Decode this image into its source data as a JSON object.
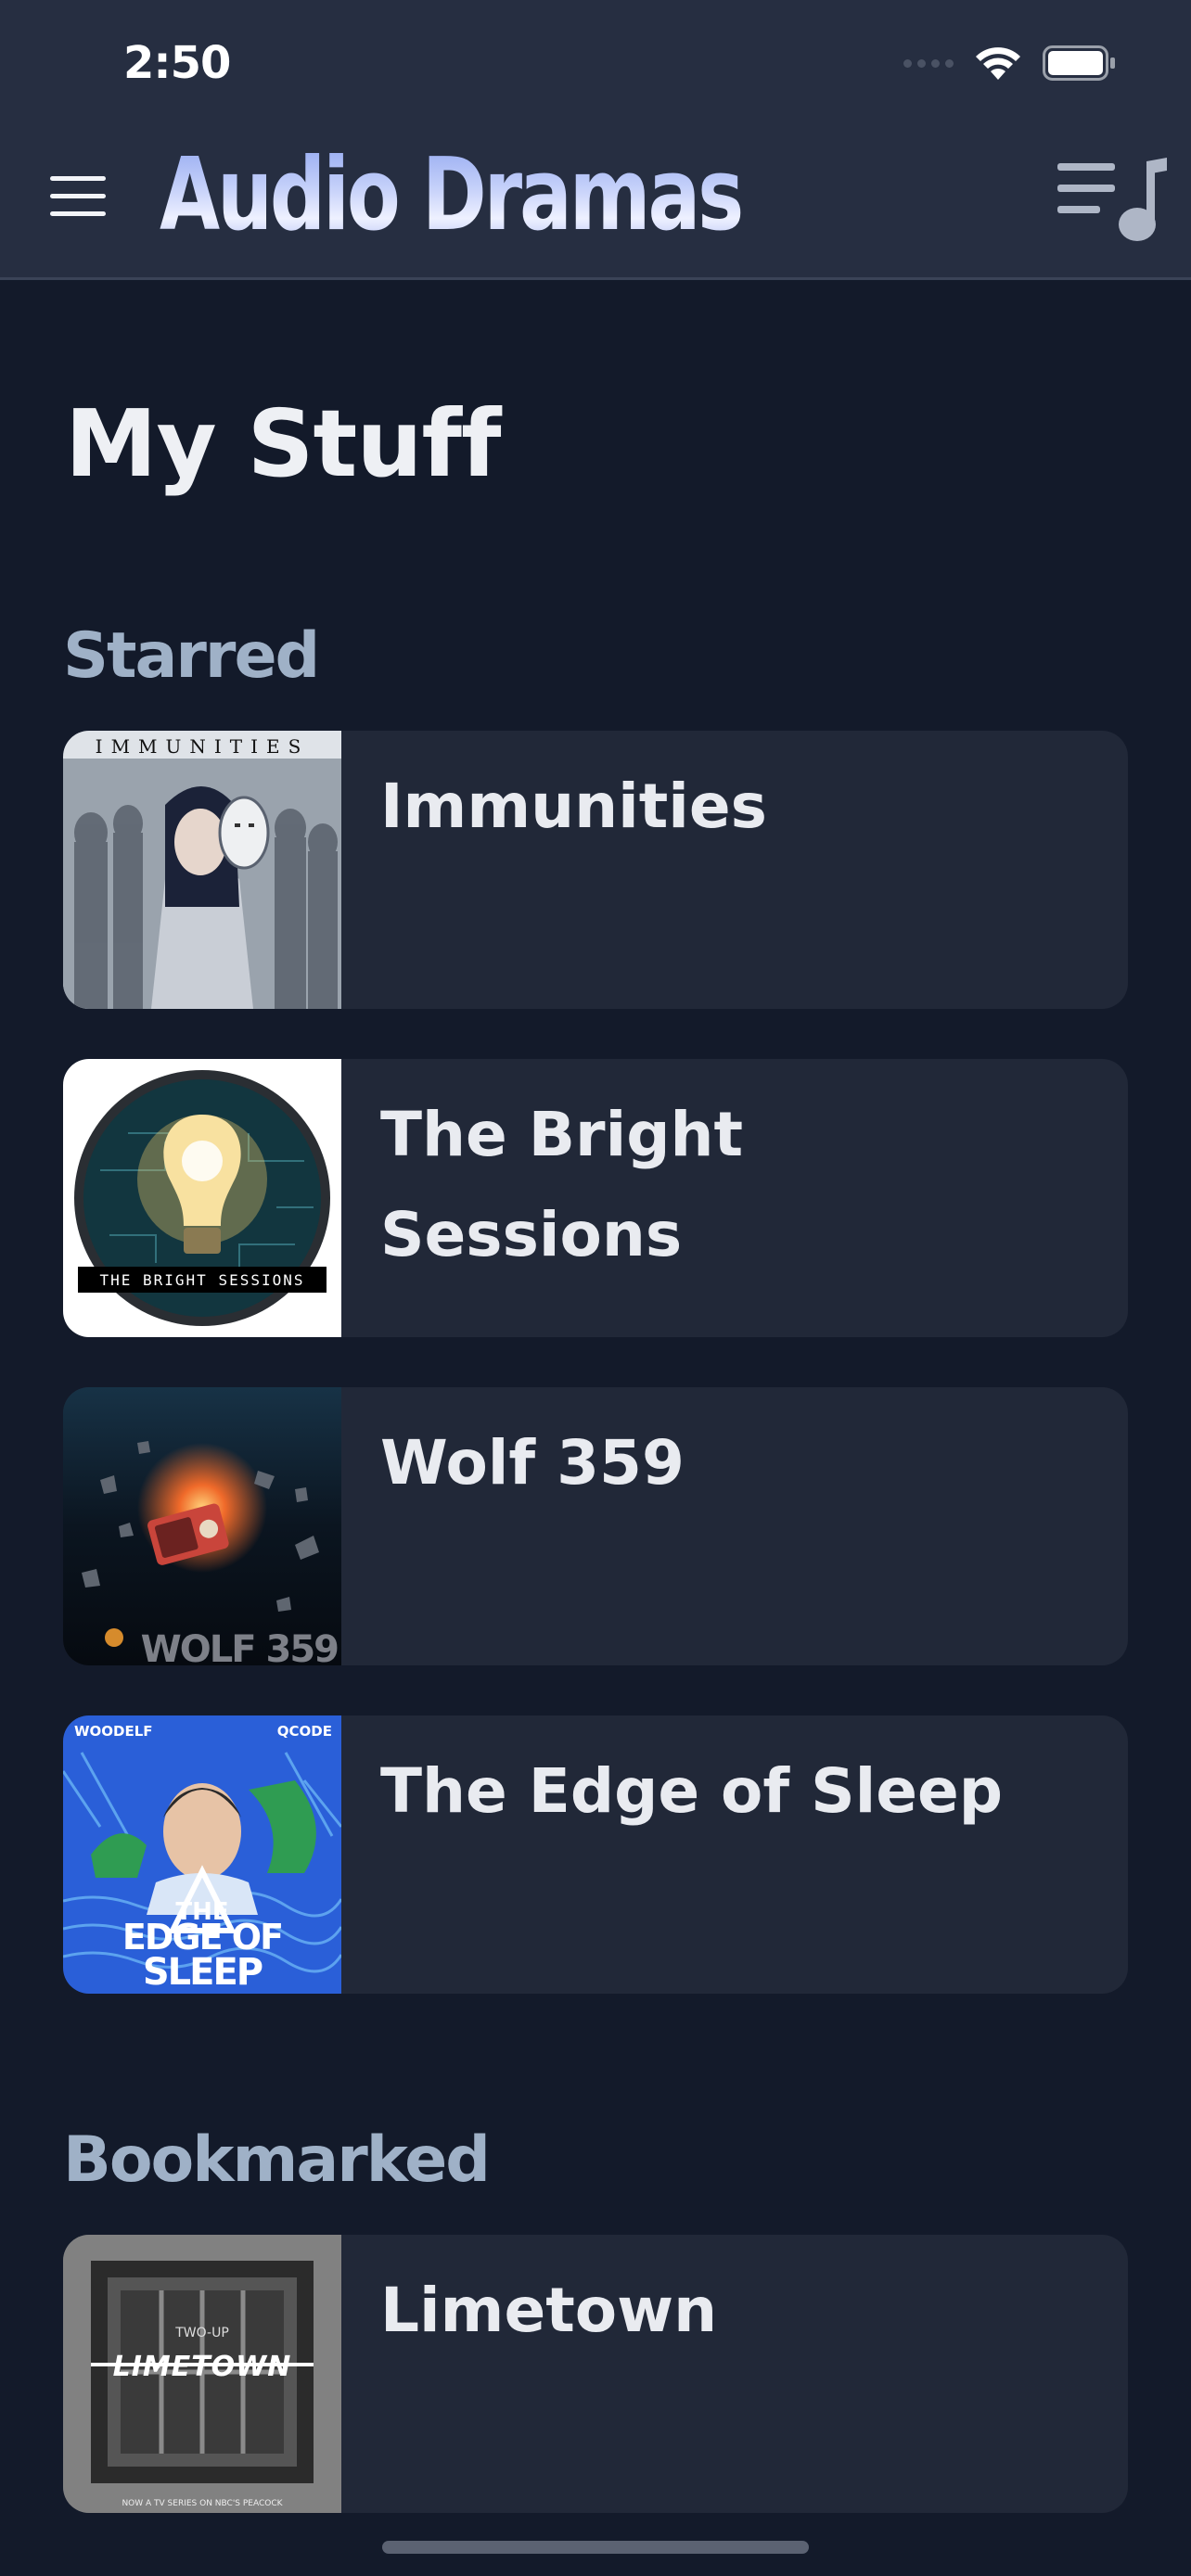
{
  "status_bar": {
    "time": "2:50"
  },
  "header": {
    "title": "Audio Dramas",
    "menu_icon": "hamburger-menu-icon",
    "queue_icon": "music-queue-icon"
  },
  "page": {
    "title": "My Stuff"
  },
  "sections": {
    "starred": {
      "heading": "Starred",
      "items": [
        {
          "title": "Immunities",
          "artwork_text": "IMMUNITIES"
        },
        {
          "title": "The Bright Sessions",
          "artwork_text": "THE BRIGHT SESSIONS"
        },
        {
          "title": "Wolf 359",
          "artwork_text": "WOLF 359"
        },
        {
          "title": "The Edge of Sleep",
          "artwork_text": {
            "line1": "THE",
            "line2": "EDGE OF",
            "line3": "SLEEP",
            "brand_left": "WOODELF",
            "brand_right": "QCODE"
          }
        }
      ]
    },
    "bookmarked": {
      "heading": "Bookmarked",
      "items": [
        {
          "title": "Limetown",
          "artwork_text": {
            "top": "TWO-UP",
            "title": "LIMETOWN",
            "footer": "NOW A TV SERIES ON NBC'S PEACOCK"
          }
        }
      ]
    }
  },
  "colors": {
    "background": "#131a2a",
    "header": "#262e41",
    "card": "#212838",
    "section_heading": "#9fb1c7"
  }
}
